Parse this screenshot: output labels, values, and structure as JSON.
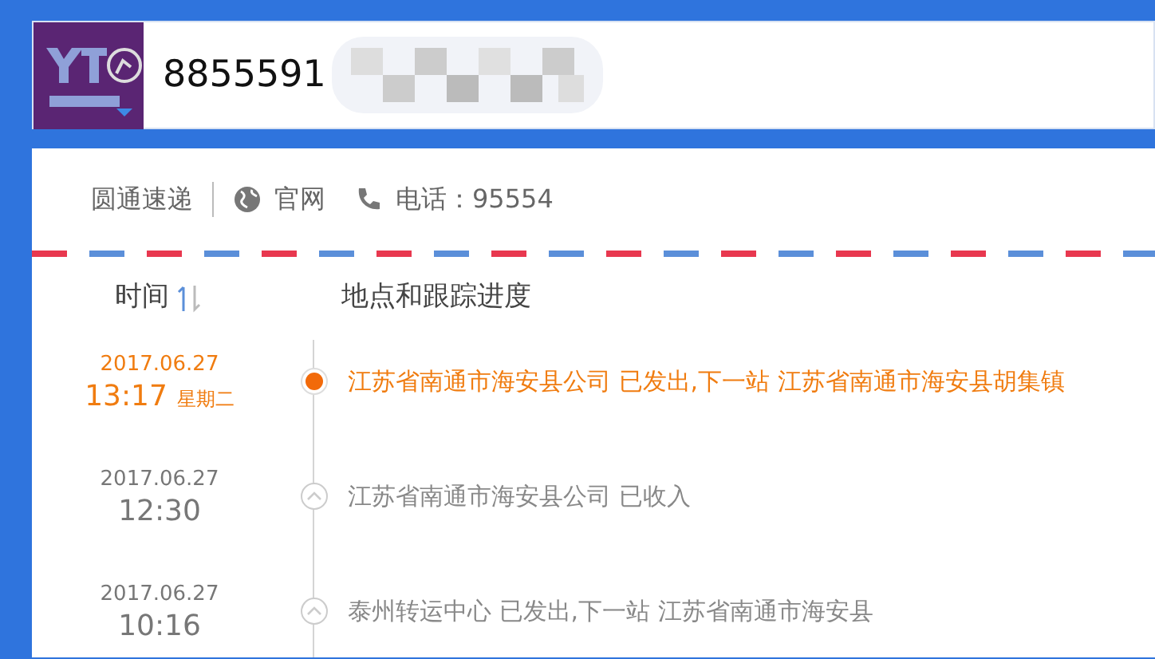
{
  "search": {
    "value": "8855591"
  },
  "carrier": {
    "name": "圆通速递",
    "website": "官网",
    "phone": "电话：95554"
  },
  "table": {
    "columns": [
      "时间",
      "地点和跟踪进度"
    ],
    "rows": [
      {
        "date": "2017.06.27",
        "time": "13:17",
        "weekday": "星期二",
        "description": "江苏省南通市海安县公司 已发出,下一站 江苏省南通市海安县胡集镇",
        "latest": true
      },
      {
        "date": "2017.06.27",
        "time": "12:30",
        "description": "江苏省南通市海安县公司 已收入",
        "latest": false
      },
      {
        "date": "2017.06.27",
        "time": "10:16",
        "description": "泰州转运中心 已发出,下一站 江苏省南通市海安县",
        "latest": false
      }
    ]
  }
}
